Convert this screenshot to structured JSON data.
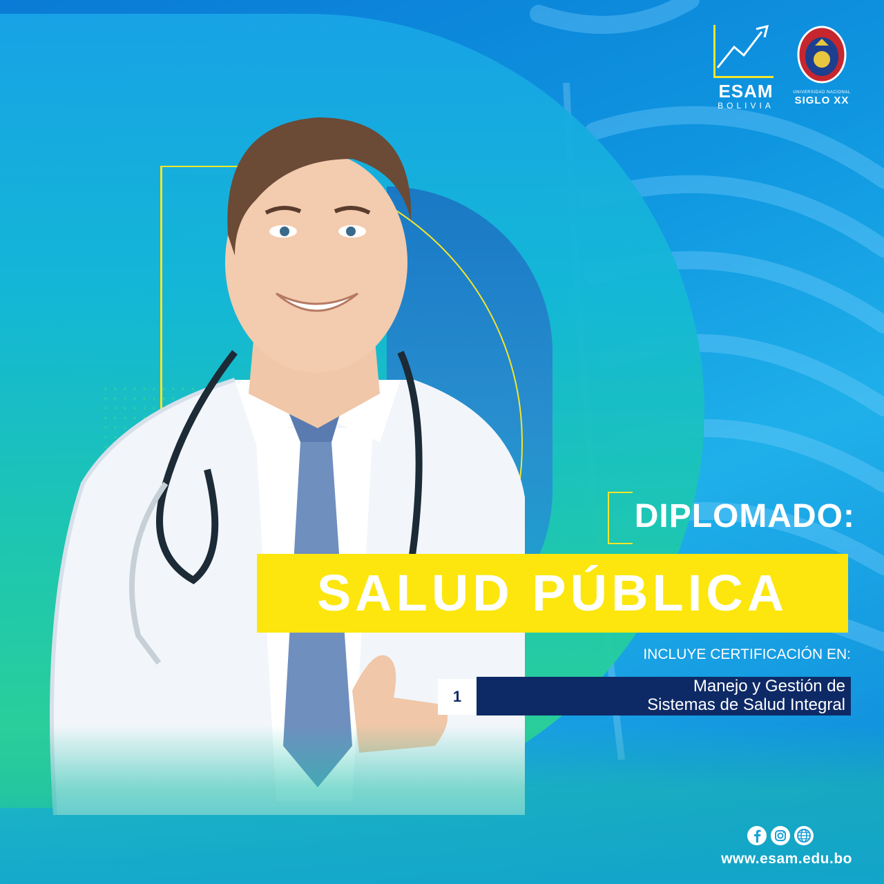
{
  "brand": {
    "esam_name": "ESAM",
    "esam_sub": "BOLIVIA",
    "univ_small": "UNIVERSIDAD NACIONAL",
    "univ_name": "SIGLO XX"
  },
  "program": {
    "kind": "DIPLOMADO:",
    "title": "SALUD PÚBLICA",
    "includes": "INCLUYE CERTIFICACIÓN EN:",
    "certifications": [
      {
        "number": "1",
        "line1": "Manejo y Gestión de",
        "line2": "Sistemas de Salud Integral"
      }
    ]
  },
  "footer": {
    "social_icons": [
      "facebook-icon",
      "instagram-icon",
      "globe-icon"
    ],
    "url": "www.esam.edu.bo"
  },
  "colors": {
    "accent_yellow": "#fce60d",
    "navy": "#0e2a66",
    "blue": "#0f96e0",
    "green": "#2fd38d"
  }
}
